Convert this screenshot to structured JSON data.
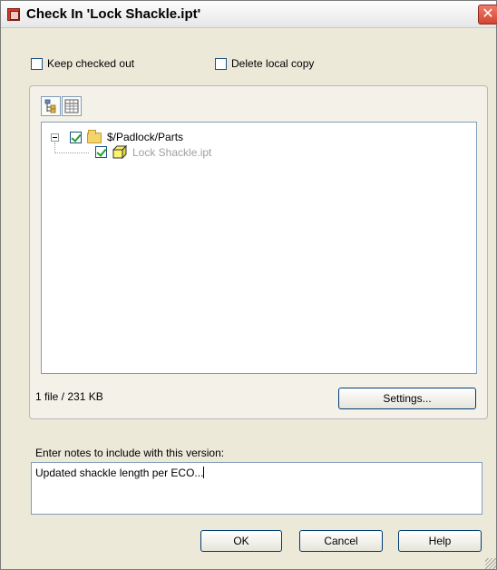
{
  "window": {
    "title": "Check In 'Lock Shackle.ipt'",
    "close_glyph": "✕"
  },
  "options": {
    "keep_checked_out": {
      "label": "Keep checked out",
      "checked": false
    },
    "delete_local_copy": {
      "label": "Delete local copy",
      "checked": false
    }
  },
  "view_buttons": [
    {
      "name": "tree-view",
      "icon": "tree-view-icon"
    },
    {
      "name": "list-view",
      "icon": "list-view-icon"
    }
  ],
  "tree": {
    "root": {
      "label": "$/Padlock/Parts",
      "checked": true,
      "expanded": true,
      "icon": "folder-icon"
    },
    "child": {
      "label": "Lock Shackle.ipt",
      "checked": true,
      "icon": "part-icon"
    }
  },
  "summary": {
    "text": "1 file / 231 KB"
  },
  "buttons": {
    "settings": "Settings...",
    "ok": "OK",
    "cancel": "Cancel",
    "help": "Help"
  },
  "notes": {
    "label": "Enter notes to include with this version:",
    "value": "Updated shackle length per ECO..."
  },
  "colors": {
    "dialog_bg": "#ece9d8",
    "close_button": "#d24632",
    "child_label": "#a0a0a0"
  }
}
